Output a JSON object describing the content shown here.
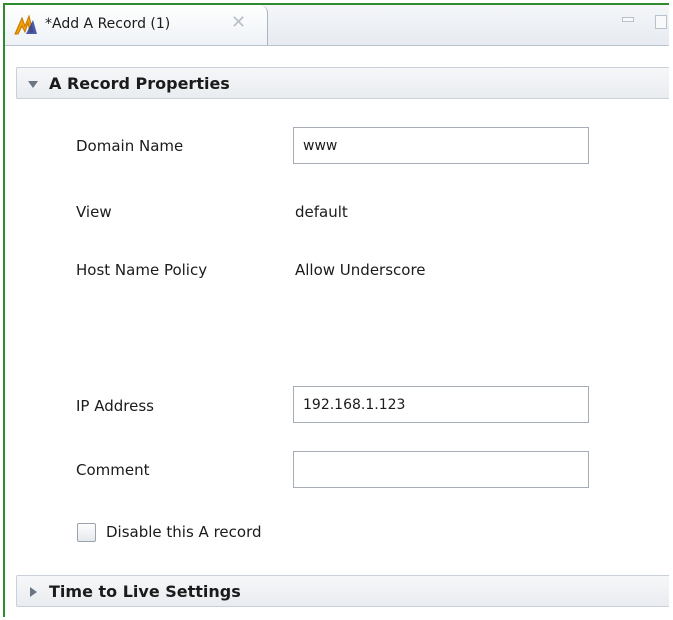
{
  "tab": {
    "title": "*Add A Record (1)",
    "icon": "record-wizard-icon",
    "close_glyph": "✕"
  },
  "window_controls": {
    "minimize_icon": "minimize-icon",
    "maximize_icon": "maximize-icon"
  },
  "sections": {
    "properties": {
      "title": "A Record Properties",
      "expanded": true
    },
    "ttl": {
      "title": "Time to Live Settings",
      "expanded": false
    }
  },
  "form": {
    "domain_name": {
      "label": "Domain Name",
      "value": "www"
    },
    "view": {
      "label": "View",
      "value": "default"
    },
    "host_name_policy": {
      "label": "Host Name Policy",
      "value": "Allow Underscore"
    },
    "ip_address": {
      "label": "IP Address",
      "value": "192.168.1.123"
    },
    "comment": {
      "label": "Comment",
      "value": ""
    },
    "disable_record": {
      "label": "Disable this A record",
      "checked": false
    }
  },
  "colors": {
    "frame_border": "#2e8b2e",
    "header_bg": "#e9ecf0",
    "input_border": "#a6adb6"
  }
}
